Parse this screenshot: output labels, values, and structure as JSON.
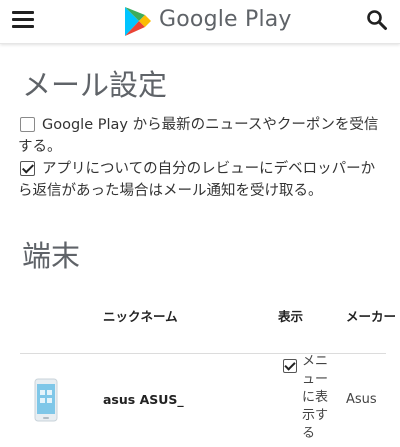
{
  "header": {
    "logo_text": "Google Play",
    "menu_icon": "hamburger-menu-icon",
    "search_icon": "search-icon"
  },
  "email_settings": {
    "title": "メール設定",
    "options": [
      {
        "label": "Google Play から最新のニュースやクーポンを受信する。",
        "checked": false
      },
      {
        "label": "アプリについての自分のレビューにデベロッパーから返信があった場合はメール通知を受け取る。",
        "checked": true
      }
    ]
  },
  "devices": {
    "title": "端末",
    "columns": {
      "nickname": "ニックネーム",
      "show": "表示",
      "maker": "メーカー"
    },
    "rows": [
      {
        "nickname": "asus ASUS_",
        "show_checked": true,
        "show_label": "メニューに表示する",
        "maker": "Asus"
      }
    ]
  },
  "colors": {
    "play_green": "#34A853",
    "play_blue": "#4285F4",
    "play_yellow": "#FBBC04",
    "play_red": "#EA4335",
    "title_gray": "#5f6368"
  }
}
